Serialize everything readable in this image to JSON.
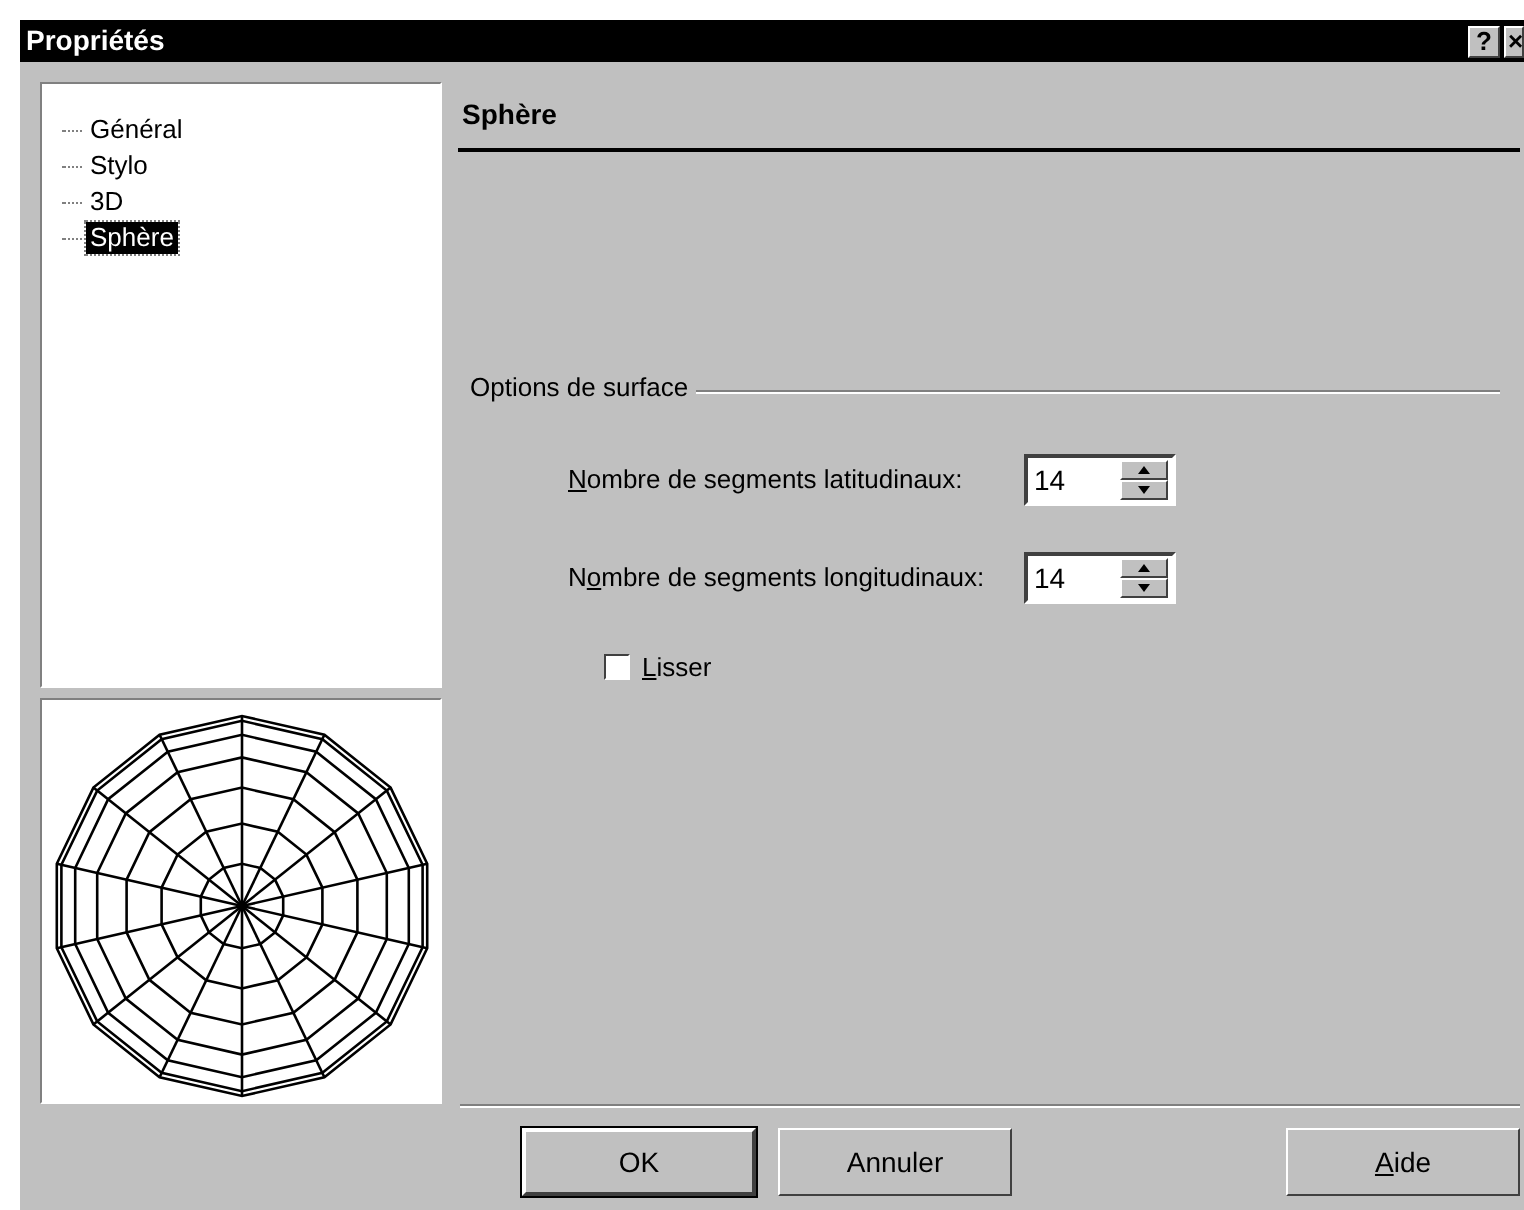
{
  "window": {
    "title": "Propriétés",
    "title_buttons": [
      "?",
      "×"
    ]
  },
  "tree": [
    {
      "label": "Général",
      "selected": false
    },
    {
      "label": "Stylo",
      "selected": false
    },
    {
      "label": "3D",
      "selected": false
    },
    {
      "label": "Sphère",
      "selected": true
    }
  ],
  "preview": {
    "kind": "sphere-wireframe"
  },
  "page": {
    "heading": "Sphère",
    "group": "Options de surface",
    "fields": [
      {
        "access_key": "N",
        "label_end": "ombre de segments latitudinaux:",
        "value": "14"
      },
      {
        "label_start": "N",
        "access_key": "o",
        "label_end": "mbre de segments longitudinaux:",
        "value": "14"
      }
    ],
    "checkbox": {
      "access_key": "L",
      "label_end": "isser",
      "checked": false
    }
  },
  "buttons": [
    {
      "label_end": "OK",
      "default": true
    },
    {
      "label_end": "Annuler",
      "default": false
    },
    {
      "access_key": "A",
      "label_end": "ide",
      "default": false
    }
  ]
}
